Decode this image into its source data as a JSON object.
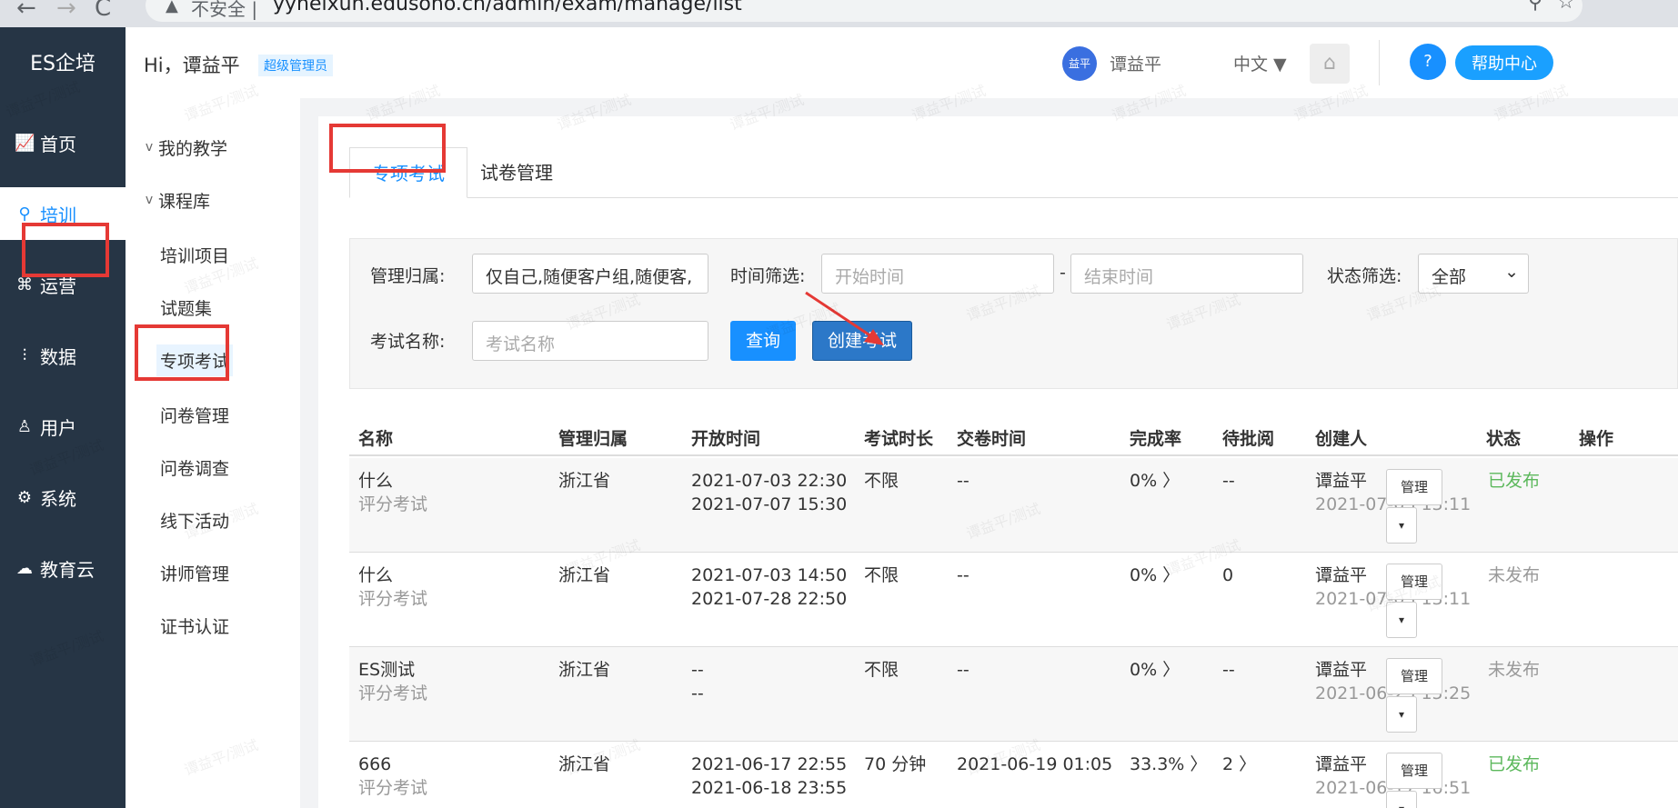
{
  "browser": {
    "back": "←",
    "forward": "→",
    "reload": "C",
    "warn_icon": "▲",
    "insecure": "不安全 |",
    "url": "yyheixun.edusoho.cn/admin/exam/manage/list"
  },
  "sidebar": {
    "logo": "ES企培",
    "items": [
      {
        "label": "首页",
        "icon": "chart-icon"
      },
      {
        "label": "培训",
        "icon": "training-icon"
      },
      {
        "label": "运营",
        "icon": "operate-icon"
      },
      {
        "label": "数据",
        "icon": "data-icon"
      },
      {
        "label": "用户",
        "icon": "user-icon"
      },
      {
        "label": "系统",
        "icon": "gear-icon"
      },
      {
        "label": "教育云",
        "icon": "cloud-icon"
      }
    ]
  },
  "submenu": {
    "items": [
      {
        "label": "我的教学",
        "caret": "v"
      },
      {
        "label": "课程库",
        "caret": "v"
      },
      {
        "label": "培训项目"
      },
      {
        "label": "试题集"
      },
      {
        "label": "专项考试"
      },
      {
        "label": "问卷管理"
      },
      {
        "label": "问卷调查"
      },
      {
        "label": "线下活动"
      },
      {
        "label": "讲师管理"
      },
      {
        "label": "证书认证"
      }
    ]
  },
  "header": {
    "greeting": "Hi，谭益平",
    "role": "超级管理员",
    "avatar_text": "益平",
    "username": "谭益平",
    "language": "中文 ▼",
    "help_icon": "?",
    "help_label": "帮助中心"
  },
  "tabs": [
    {
      "label": "专项考试",
      "active": true
    },
    {
      "label": "试卷管理",
      "active": false
    }
  ],
  "filter": {
    "owner_label": "管理归属:",
    "owner_value": "仅自己,随便客户组,随便客,",
    "time_label": "时间筛选:",
    "start_placeholder": "开始时间",
    "separator": "-",
    "end_placeholder": "结束时间",
    "status_label": "状态筛选:",
    "status_value": "全部",
    "status_caret": "⌄",
    "name_label": "考试名称:",
    "name_placeholder": "考试名称",
    "query_button": "查询",
    "create_button": "创建考试"
  },
  "table": {
    "headers": [
      "名称",
      "管理归属",
      "开放时间",
      "考试时长",
      "交卷时间",
      "完成率",
      "待批阅",
      "创建人",
      "状态",
      "操作"
    ],
    "rows": [
      {
        "name": "什么",
        "type": "评分考试",
        "owner": "浙江省",
        "open_start": "2021-07-03 22:30",
        "open_end": "2021-07-07 15:30",
        "duration": "不限",
        "submit_time": "--",
        "rate": "0% 〉",
        "pending": "--",
        "creator": "谭益平",
        "created": "2021-07-03 13:11",
        "status": "已发布",
        "published": true,
        "manage": "管理",
        "caret": "▾"
      },
      {
        "name": "什么",
        "type": "评分考试",
        "owner": "浙江省",
        "open_start": "2021-07-03 14:50",
        "open_end": "2021-07-28 22:50",
        "duration": "不限",
        "submit_time": "--",
        "rate": "0% 〉",
        "pending": "0",
        "creator": "谭益平",
        "created": "2021-07-03 13:11",
        "status": "未发布",
        "published": false,
        "manage": "管理",
        "caret": "▾"
      },
      {
        "name": "ES测试",
        "type": "评分考试",
        "owner": "浙江省",
        "open_start": "--",
        "open_end": "--",
        "duration": "不限",
        "submit_time": "--",
        "rate": "0% 〉",
        "pending": "--",
        "creator": "谭益平",
        "created": "2021-06-25 15:25",
        "status": "未发布",
        "published": false,
        "manage": "管理",
        "caret": "▾"
      },
      {
        "name": "666",
        "type": "评分考试",
        "owner": "浙江省",
        "open_start": "2021-06-17 22:55",
        "open_end": "2021-06-18 23:55",
        "duration": "70 分钟",
        "submit_time": "2021-06-19 01:05",
        "rate": "33.3% 〉",
        "pending": "2 〉",
        "creator": "谭益平",
        "created": "2021-06-17 16:51",
        "status": "已发布",
        "published": true,
        "manage": "管理",
        "caret": "▾"
      }
    ]
  },
  "watermark": "谭益平/测试",
  "colors": {
    "sidebar_bg": "#263545",
    "accent": "#1890ff",
    "published": "#5cb85c",
    "annotation_red": "#e53935"
  }
}
